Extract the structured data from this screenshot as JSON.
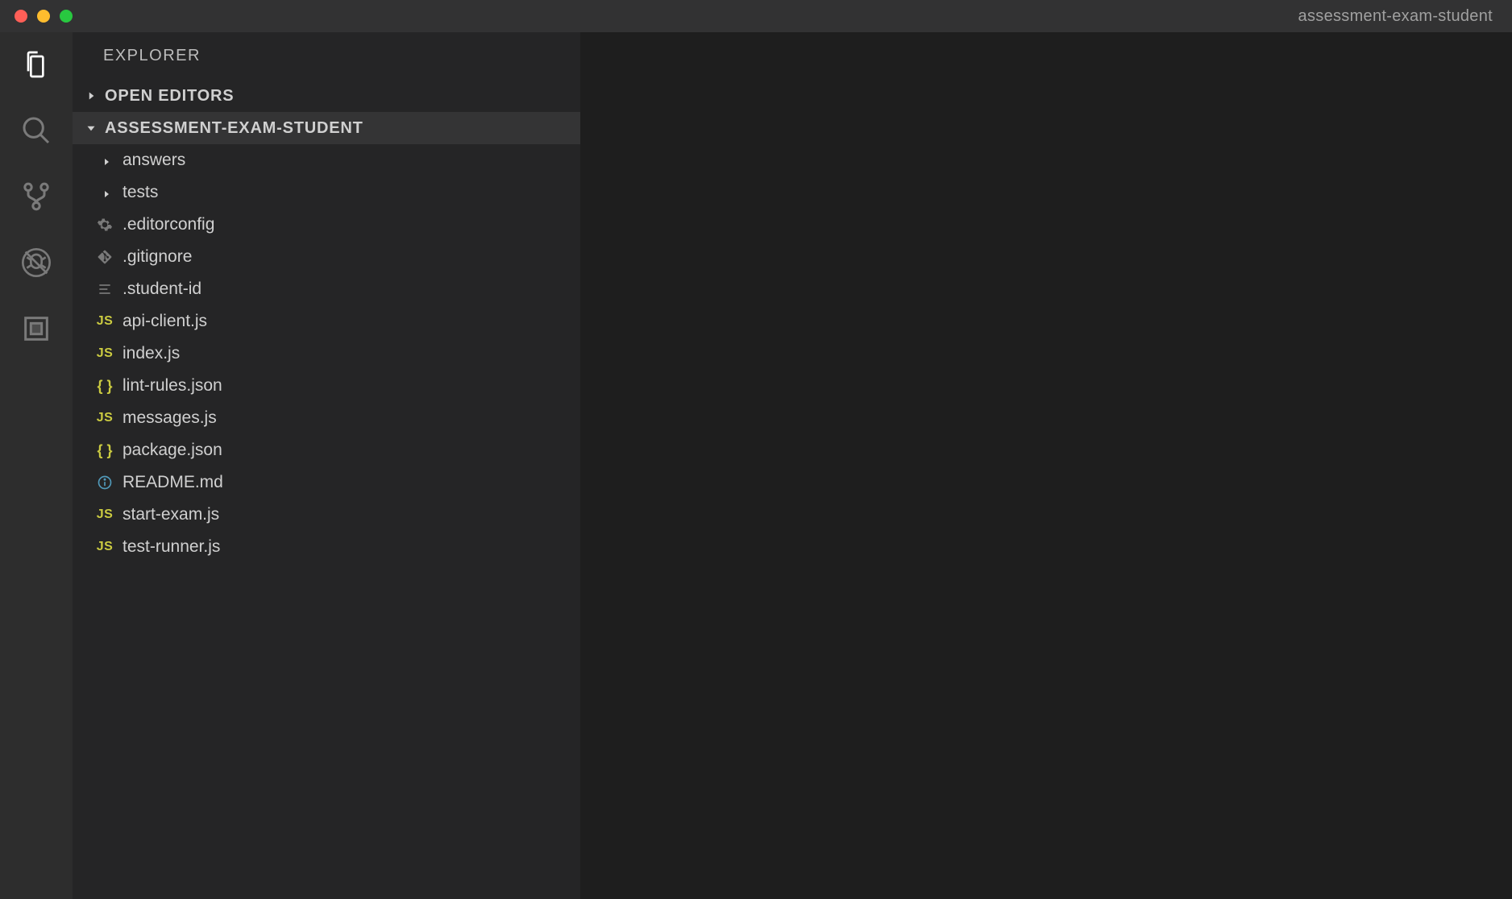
{
  "window": {
    "title": "assessment-exam-student"
  },
  "sidebar": {
    "title": "EXPLORER",
    "sections": {
      "open_editors": {
        "label": "OPEN EDITORS",
        "expanded": false
      },
      "project": {
        "label": "ASSESSMENT-EXAM-STUDENT",
        "expanded": true
      }
    }
  },
  "tree": {
    "folders": [
      {
        "name": "answers"
      },
      {
        "name": "tests"
      }
    ],
    "files": [
      {
        "name": ".editorconfig",
        "icon": "gear"
      },
      {
        "name": ".gitignore",
        "icon": "git"
      },
      {
        "name": ".student-id",
        "icon": "lines"
      },
      {
        "name": "api-client.js",
        "icon": "js"
      },
      {
        "name": "index.js",
        "icon": "js"
      },
      {
        "name": "lint-rules.json",
        "icon": "json"
      },
      {
        "name": "messages.js",
        "icon": "js"
      },
      {
        "name": "package.json",
        "icon": "json"
      },
      {
        "name": "README.md",
        "icon": "info"
      },
      {
        "name": "start-exam.js",
        "icon": "js"
      },
      {
        "name": "test-runner.js",
        "icon": "js"
      }
    ]
  }
}
